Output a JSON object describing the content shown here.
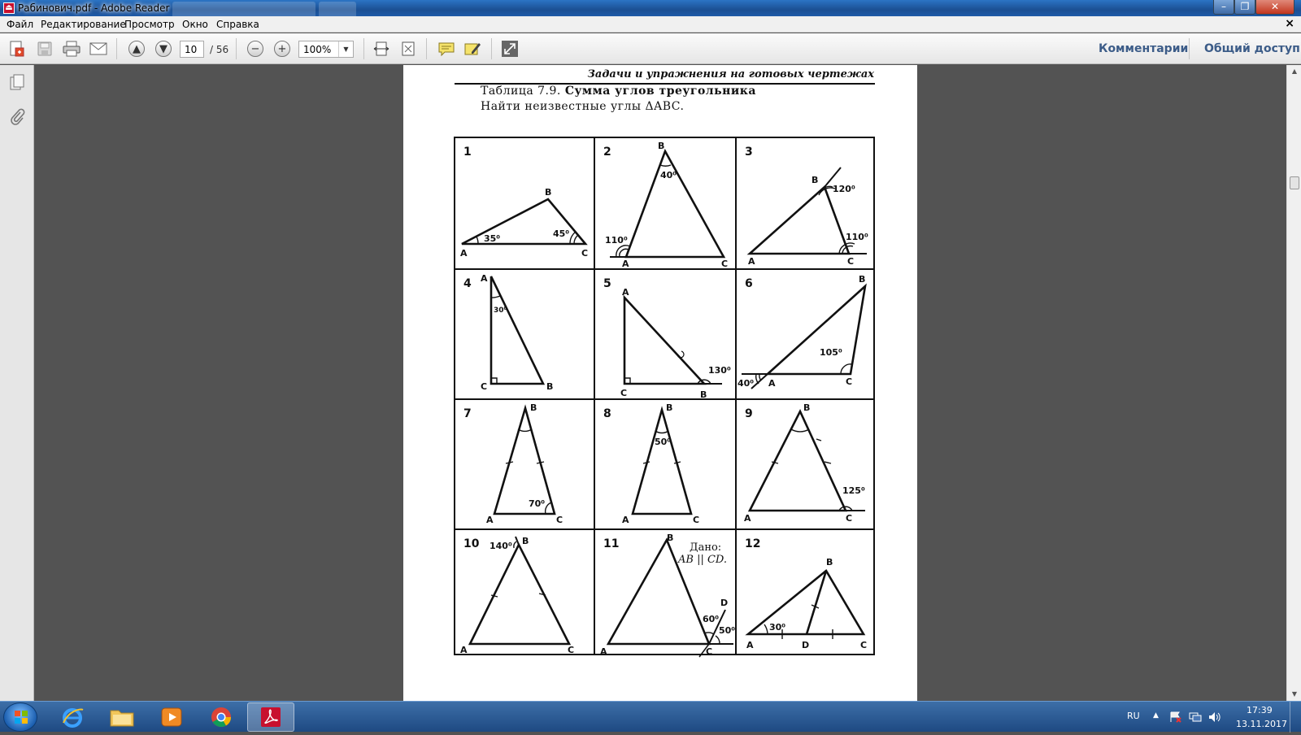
{
  "window": {
    "title": "Рабинович.pdf - Adobe Reader",
    "controls": [
      "–",
      "❐",
      "✕"
    ]
  },
  "menu": {
    "items": [
      "Файл",
      "Редактирование",
      "Просмотр",
      "Окно",
      "Справка"
    ],
    "close": "×"
  },
  "toolbar": {
    "page_current": "10",
    "page_total": "/ 56",
    "zoom": "100%",
    "comments_label": "Комментарии",
    "share_label": "Общий доступ"
  },
  "document": {
    "running_head": "Задачи и упражнения на готовых чертежах",
    "table_prefix": "Таблица 7.9.",
    "table_title": "Сумма углов треугольника",
    "instruction": "Найти неизвестные углы ΔABC.",
    "problems": [
      {
        "num": "1",
        "labels": {
          "A": "A",
          "B": "B",
          "C": "C"
        },
        "angles": [
          "35⁰",
          "45⁰"
        ]
      },
      {
        "num": "2",
        "labels": {
          "A": "A",
          "B": "B",
          "C": "C"
        },
        "angles": [
          "40⁰",
          "110⁰"
        ]
      },
      {
        "num": "3",
        "labels": {
          "A": "A",
          "B": "B",
          "C": "C"
        },
        "angles": [
          "120⁰",
          "110⁰"
        ]
      },
      {
        "num": "4",
        "labels": {
          "A": "A",
          "B": "B",
          "C": "C"
        },
        "angles": [
          "30⁰"
        ]
      },
      {
        "num": "5",
        "labels": {
          "A": "A",
          "B": "B",
          "C": "C"
        },
        "angles": [
          "130⁰"
        ]
      },
      {
        "num": "6",
        "labels": {
          "A": "A",
          "B": "B",
          "C": "C"
        },
        "angles": [
          "105⁰",
          "40⁰"
        ]
      },
      {
        "num": "7",
        "labels": {
          "A": "A",
          "B": "B",
          "C": "C"
        },
        "angles": [
          "70⁰"
        ]
      },
      {
        "num": "8",
        "labels": {
          "A": "A",
          "B": "B",
          "C": "C"
        },
        "angles": [
          "50⁰"
        ]
      },
      {
        "num": "9",
        "labels": {
          "A": "A",
          "B": "B",
          "C": "C"
        },
        "angles": [
          "125⁰"
        ]
      },
      {
        "num": "10",
        "labels": {
          "A": "A",
          "B": "B",
          "C": "C"
        },
        "angles": [
          "140⁰"
        ]
      },
      {
        "num": "11",
        "labels": {
          "A": "A",
          "B": "B",
          "C": "C",
          "D": "D"
        },
        "angles": [
          "60⁰",
          "50⁰"
        ],
        "given_title": "Дано:",
        "given_text": "AB || CD."
      },
      {
        "num": "12",
        "labels": {
          "A": "A",
          "B": "B",
          "C": "C",
          "D": "D"
        },
        "angles": [
          "30⁰"
        ]
      }
    ]
  },
  "taskbar": {
    "lang": "RU",
    "time": "17:39",
    "date": "13.11.2017"
  }
}
